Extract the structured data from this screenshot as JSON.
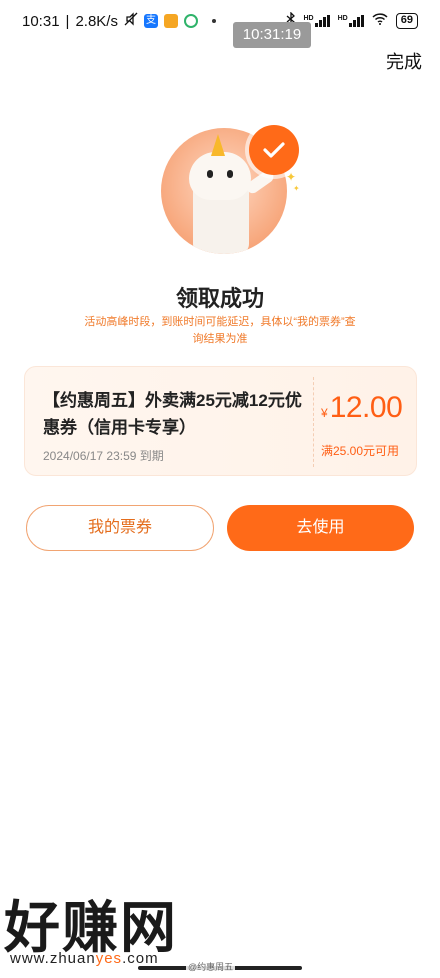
{
  "status_bar": {
    "time": "10:31",
    "network_speed": "2.8K/s",
    "alipay_icon_text": "支",
    "network_labels": [
      "HD",
      "HD"
    ],
    "battery": "69"
  },
  "time_overlay": "10:31:19",
  "header": {
    "done_label": "完成"
  },
  "result": {
    "title": "领取成功",
    "note": "活动高峰时段，到账时间可能延迟，具体以“我的票券”查询结果为准"
  },
  "coupon": {
    "name": "【约惠周五】外卖满25元减12元优惠券（信用卡专享）",
    "expiry": "2024/06/17 23:59 到期",
    "currency": "¥",
    "amount": "12.00",
    "condition": "满25.00元可用"
  },
  "actions": {
    "my_tickets": "我的票券",
    "use_now": "去使用"
  },
  "watermark": {
    "brand": "好赚网",
    "url_prefix": "www.zhuan",
    "url_highlight": "yes",
    "url_suffix": ".com",
    "weibo": "@约惠周五",
    "color_accent": "#ff6a18"
  },
  "colors": {
    "primary": "#ff6a18",
    "note_text": "#f07a2a",
    "coupon_bg": "#fff4ec"
  }
}
